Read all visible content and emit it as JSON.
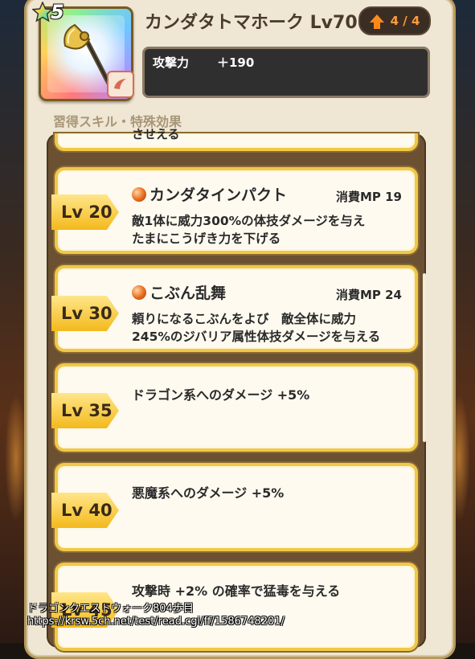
{
  "weapon": {
    "name": "カンダタトマホーク Lv70",
    "stars": "5",
    "upgrade": "4 / 4",
    "stat_label": "攻撃力",
    "stat_value": "＋190"
  },
  "section_header": "習得スキル・特殊効果",
  "skills": [
    {
      "lv": "Lv 20",
      "name": "カンダタインパクト",
      "mp": "消費MP 19",
      "desc1": "敵1体に威力300%の体技ダメージを与え",
      "desc2": "たまにこうげき力を下げる"
    },
    {
      "lv": "Lv 30",
      "name": "こぶん乱舞",
      "mp": "消費MP 24",
      "desc1": "頼りになるこぶんをよび　敵全体に威力",
      "desc2": "245%のジバリア属性体技ダメージを与える"
    }
  ],
  "passives": [
    {
      "lv": "Lv 35",
      "text": "ドラゴン系へのダメージ +5%"
    },
    {
      "lv": "Lv 40",
      "text": "悪魔系へのダメージ +5%"
    },
    {
      "lv": "Lv 45",
      "text": "攻撃時 +2% の確率で猛毒を与える"
    }
  ],
  "partial_top_text": "させえる",
  "watermark": {
    "line1": "ドラゴンクエストウォーク804歩目",
    "line2": "https://krsw.5ch.net/test/read.cgi/ff/1586748201/"
  },
  "colors": {
    "card_border": "#f0c84a",
    "lv_tag": "#f3b91c",
    "panel": "#efe6d4",
    "upgrade_accent": "#ff8a1a"
  }
}
